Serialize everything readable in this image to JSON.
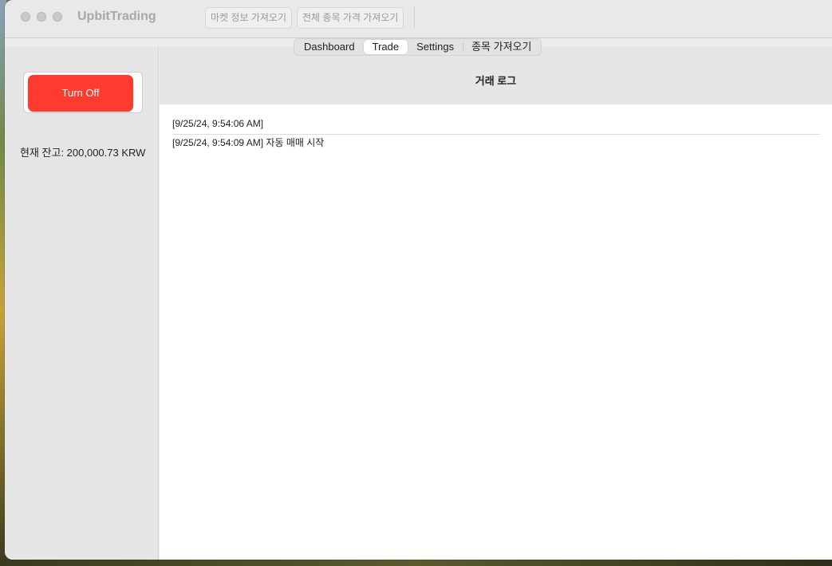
{
  "window": {
    "app_title": "UpbitTrading"
  },
  "toolbar": {
    "fetch_market_label": "마켓 정보 가져오기",
    "fetch_all_prices_label": "전체 종목 가격 가져오기"
  },
  "tabs": [
    {
      "label": "Dashboard",
      "selected": false
    },
    {
      "label": "Trade",
      "selected": true
    },
    {
      "label": "Settings",
      "selected": false
    },
    {
      "label": "종목 가져오기",
      "selected": false
    }
  ],
  "sidebar": {
    "power_button_label": "Turn Off",
    "balance_text": "현재 잔고: 200,000.73 KRW"
  },
  "main": {
    "log_title": "거래 로그",
    "log_entries": [
      "[9/25/24, 9:54:06 AM]",
      "[9/25/24, 9:54:09 AM] 자동 매매 시작"
    ]
  },
  "colors": {
    "power_button": "#ff3b30",
    "window_bg": "#ececec",
    "sidebar_bg": "#e6e6e6"
  }
}
